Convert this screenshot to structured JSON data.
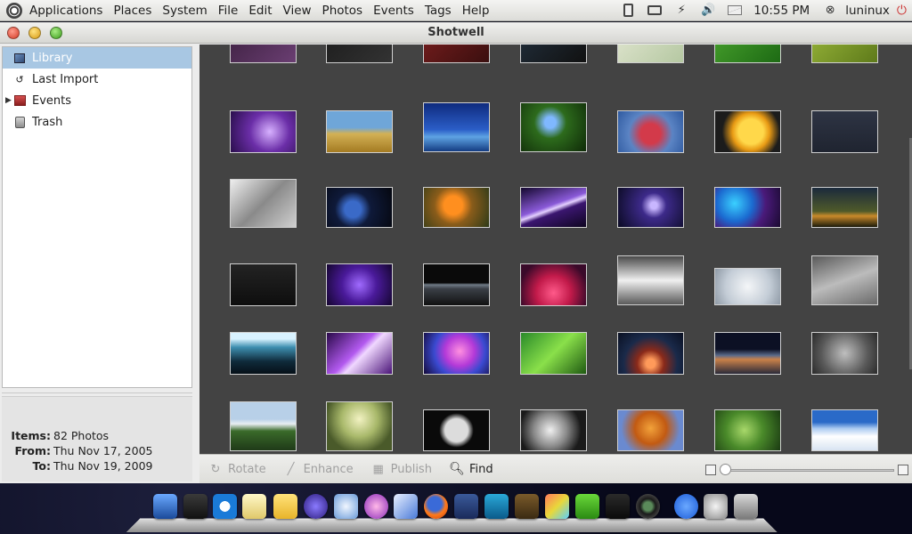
{
  "top_panel": {
    "menus": [
      "Applications",
      "Places",
      "System"
    ],
    "clock": "10:55 PM",
    "user": "luninux"
  },
  "window": {
    "title": "Shotwell",
    "menubar": [
      "File",
      "Edit",
      "View",
      "Photos",
      "Events",
      "Tags",
      "Help"
    ]
  },
  "sidebar": {
    "items": [
      {
        "label": "Library",
        "icon": "library-icon"
      },
      {
        "label": "Last Import",
        "icon": "last-import-icon"
      },
      {
        "label": "Events",
        "icon": "events-icon"
      },
      {
        "label": "Trash",
        "icon": "trash-icon"
      }
    ]
  },
  "info": {
    "items_key": "Items:",
    "items_value": "82 Photos",
    "from_key": "From:",
    "from_value": "Thu Nov 17, 2005",
    "to_key": "To:",
    "to_value": "Thu Nov 19, 2009"
  },
  "toolbar": {
    "rotate": "Rotate",
    "enhance": "Enhance",
    "publish": "Publish",
    "find": "Find",
    "zoom_level": 0.0
  },
  "colors": {
    "selection": "#a8c7e3",
    "grid_background": "#434343"
  }
}
